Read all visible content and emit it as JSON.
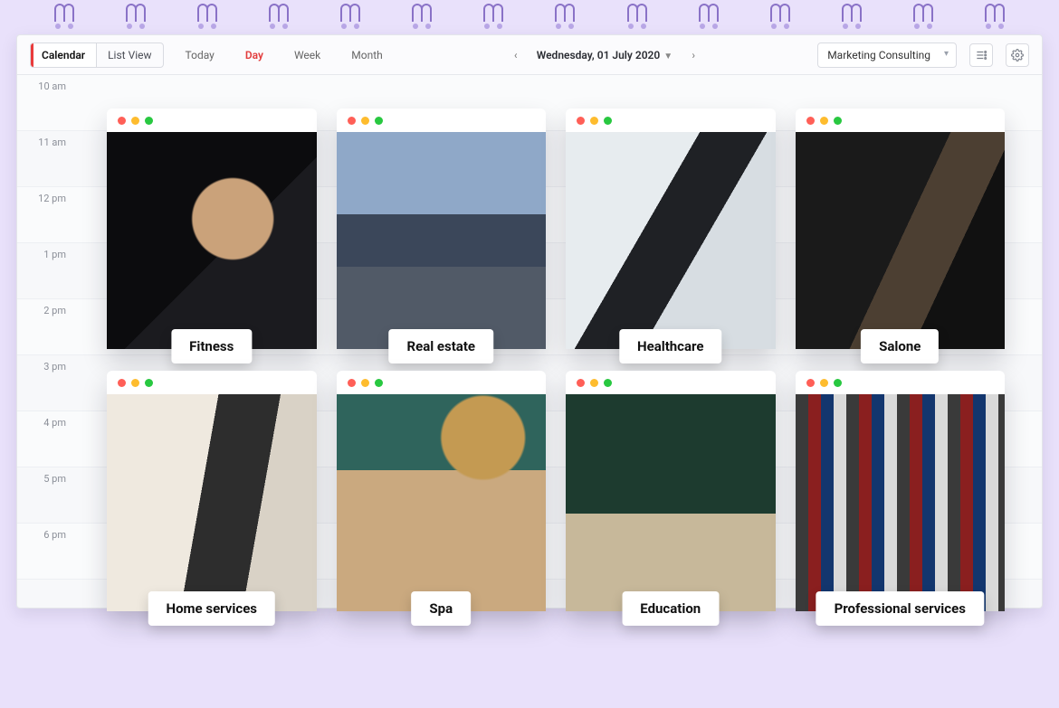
{
  "toolbar": {
    "views": {
      "calendar": "Calendar",
      "list": "List View"
    },
    "today": "Today",
    "ranges": {
      "day": "Day",
      "week": "Week",
      "month": "Month"
    },
    "date": "Wednesday, 01 July 2020",
    "service": "Marketing Consulting"
  },
  "hours": [
    "10 am",
    "11 am",
    "12 pm",
    "1 pm",
    "2 pm",
    "3 pm",
    "4 pm",
    "5 pm",
    "6 pm"
  ],
  "cards": [
    {
      "label": "Fitness",
      "scene": "sc-fitness"
    },
    {
      "label": "Real estate",
      "scene": "sc-real"
    },
    {
      "label": "Healthcare",
      "scene": "sc-health"
    },
    {
      "label": "Salone",
      "scene": "sc-salon"
    },
    {
      "label": "Home services",
      "scene": "sc-home"
    },
    {
      "label": "Spa",
      "scene": "sc-spa"
    },
    {
      "label": "Education",
      "scene": "sc-edu"
    },
    {
      "label": "Professional services",
      "scene": "sc-pro"
    }
  ]
}
